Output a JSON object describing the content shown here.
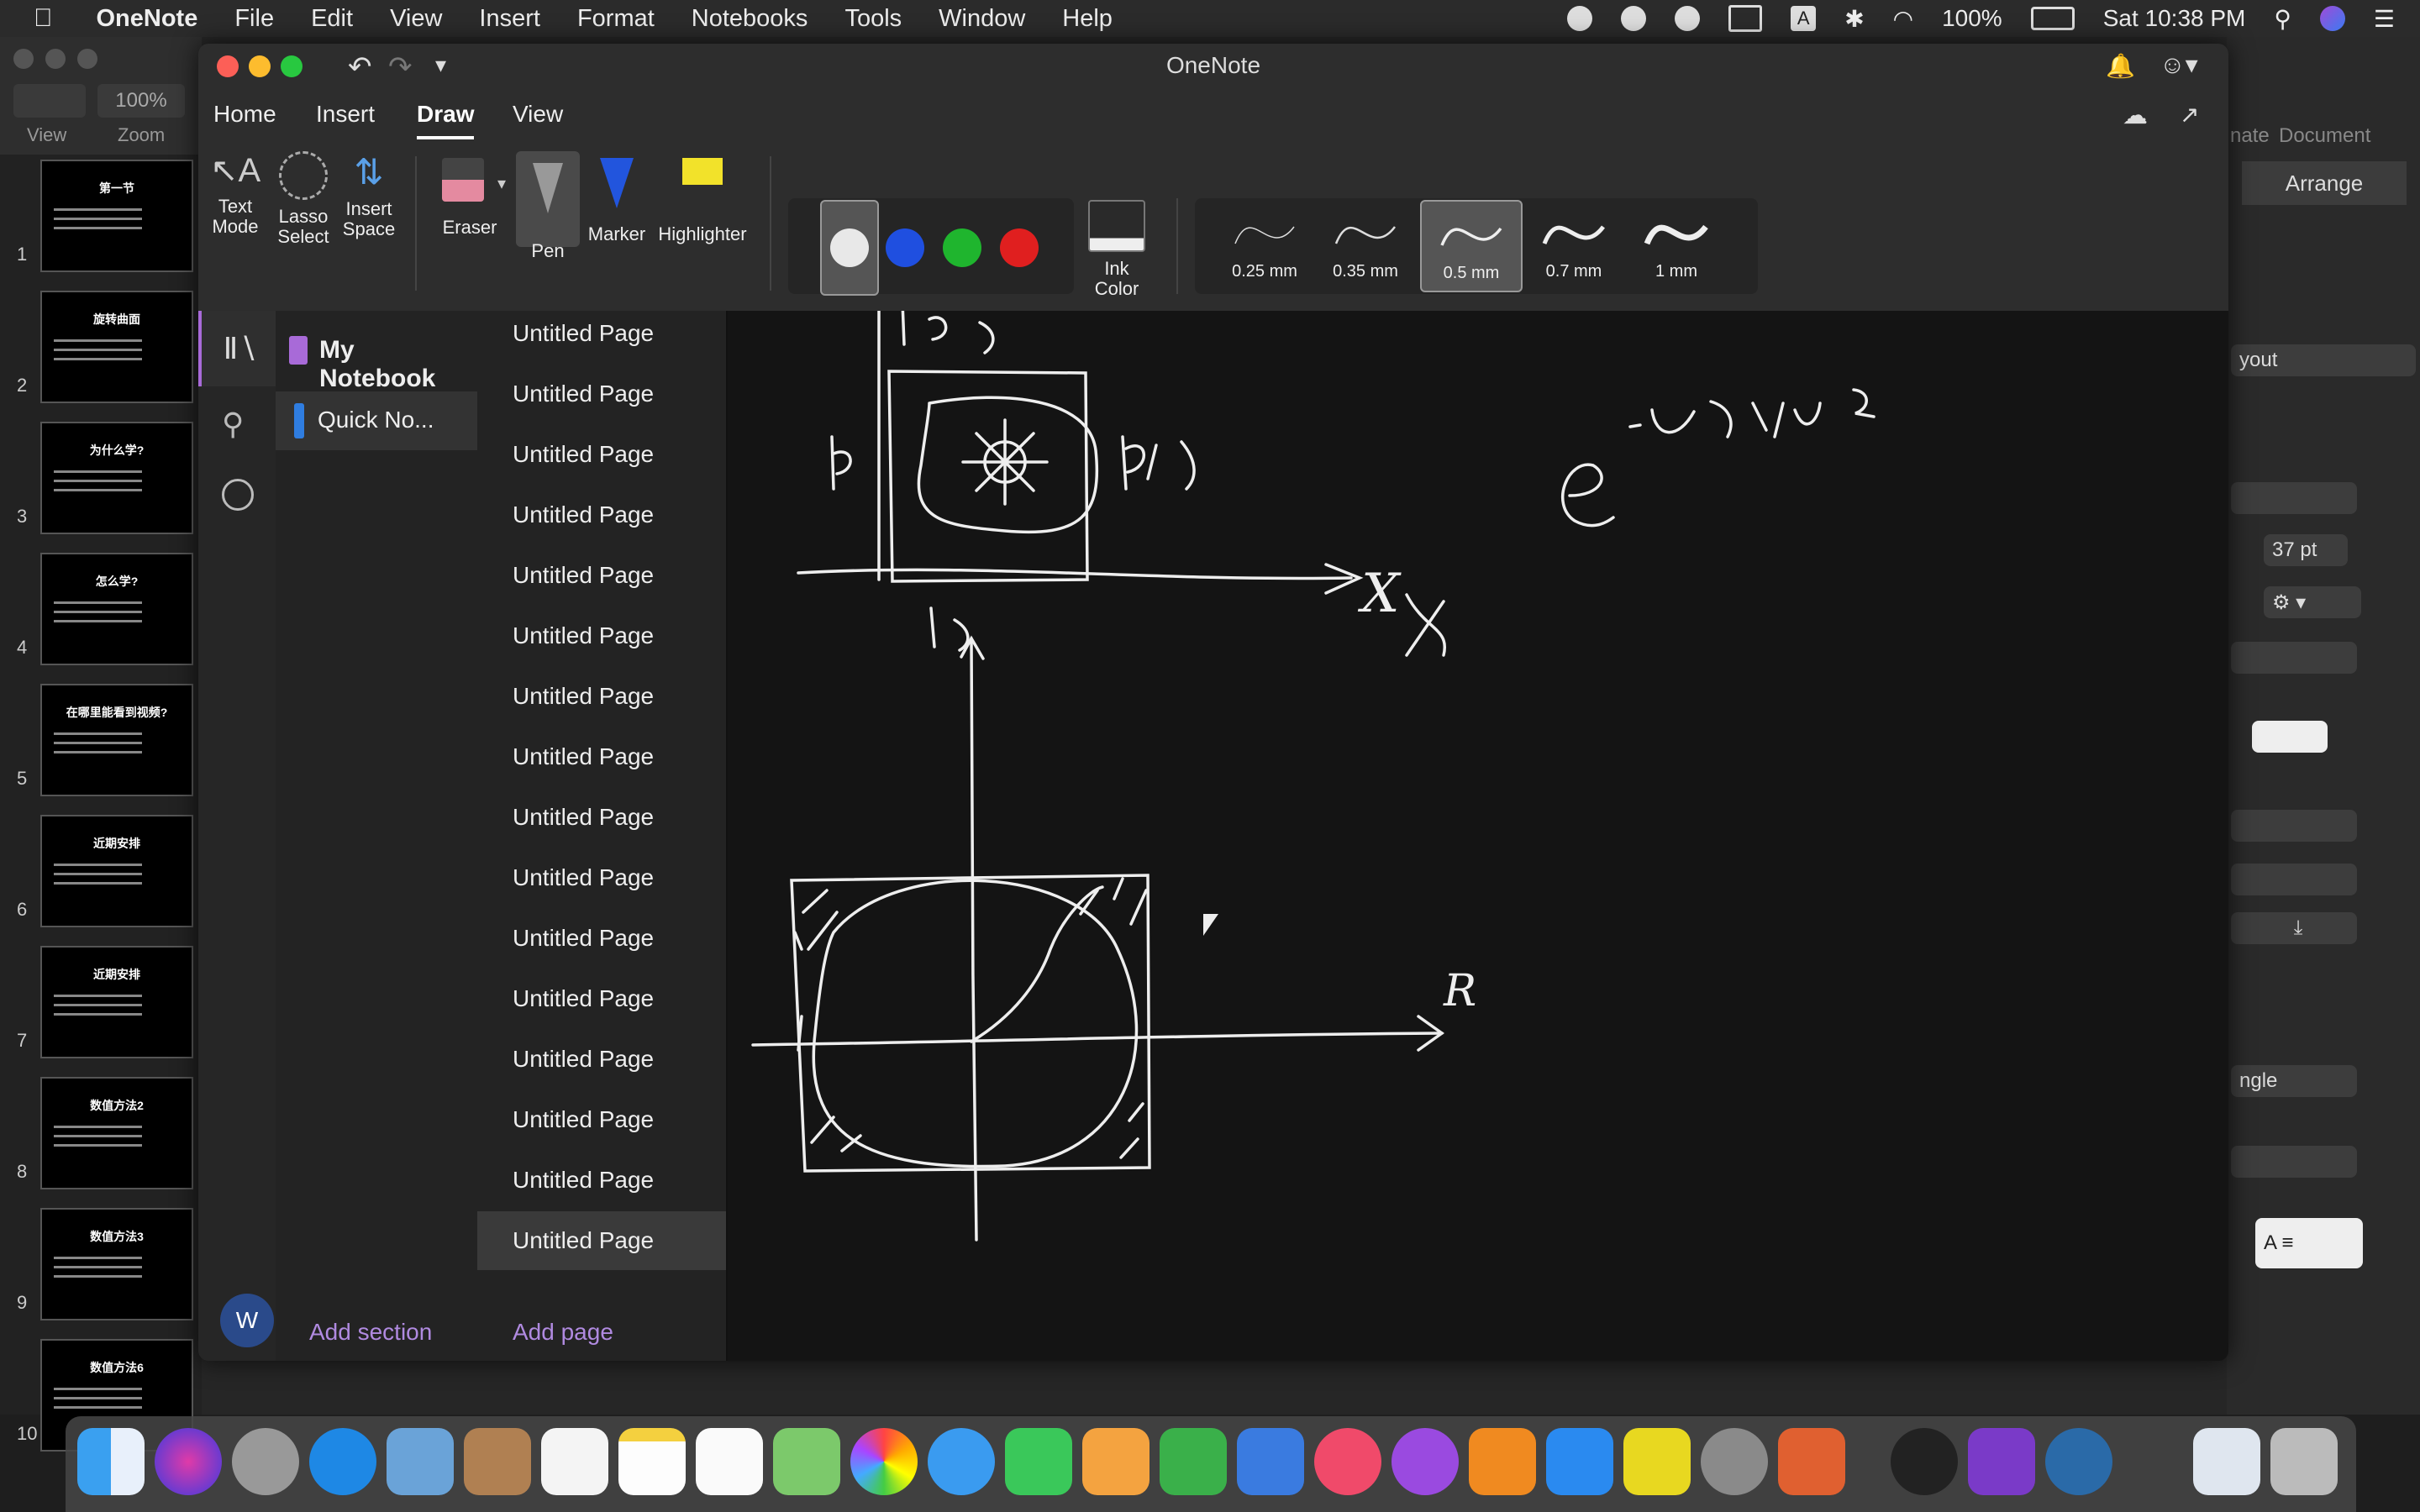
{
  "menubar": {
    "app": "OneNote",
    "items": [
      "File",
      "Edit",
      "View",
      "Insert",
      "Format",
      "Notebooks",
      "Tools",
      "Window",
      "Help"
    ],
    "battery": "100%",
    "clock": "Sat 10:38 PM"
  },
  "keynote": {
    "view_label": "View",
    "zoom_label": "Zoom",
    "zoom_value": "100%",
    "slides": [
      {
        "num": "1",
        "title": "第一节"
      },
      {
        "num": "2",
        "title": "旋转曲面"
      },
      {
        "num": "3",
        "title": "为什么学?"
      },
      {
        "num": "4",
        "title": "怎么学?"
      },
      {
        "num": "5",
        "title": "在哪里能看到视频?"
      },
      {
        "num": "6",
        "title": "近期安排"
      },
      {
        "num": "7",
        "title": "近期安排"
      },
      {
        "num": "8",
        "title": "数值方法2"
      },
      {
        "num": "9",
        "title": "数值方法3"
      },
      {
        "num": "10",
        "title": "数值方法6"
      }
    ],
    "right_panel": {
      "tab_arrange": "Arrange",
      "tab_animate": "nate",
      "tab_document": "Document",
      "layout_btn": "yout",
      "size_value": "37 pt",
      "shape_select": "ngle"
    }
  },
  "onenote": {
    "window_title": "OneNote",
    "tabs": [
      "Home",
      "Insert",
      "Draw",
      "View"
    ],
    "active_tab": "Draw",
    "ribbon": {
      "text_mode": "Text\nMode",
      "lasso_select": "Lasso\nSelect",
      "insert_space": "Insert\nSpace",
      "eraser": "Eraser",
      "pen": "Pen",
      "marker": "Marker",
      "highlighter": "Highlighter",
      "ink_color": "Ink\nColor",
      "pen_colors": [
        "#e8e8e8",
        "#1f4fe0",
        "#1fb52e",
        "#e01f1f"
      ],
      "strokes": [
        "0.25 mm",
        "0.35 mm",
        "0.5 mm",
        "0.7 mm",
        "1 mm"
      ],
      "selected_stroke": "0.5 mm"
    },
    "notebook_name": "My Notebook",
    "section_name": "Quick No...",
    "pages": [
      "Untitled Page",
      "Untitled Page",
      "Untitled Page",
      "Untitled Page",
      "Untitled Page",
      "Untitled Page",
      "Untitled Page",
      "Untitled Page",
      "Untitled Page",
      "Untitled Page",
      "Untitled Page",
      "Untitled Page",
      "Untitled Page",
      "Untitled Page",
      "Untitled Page",
      "Untitled Page"
    ],
    "add_section": "Add section",
    "add_page": "Add page",
    "avatar_initial": "W",
    "ink_labels": {
      "x_axis": "X",
      "radius": "R",
      "formula": "e"
    }
  }
}
